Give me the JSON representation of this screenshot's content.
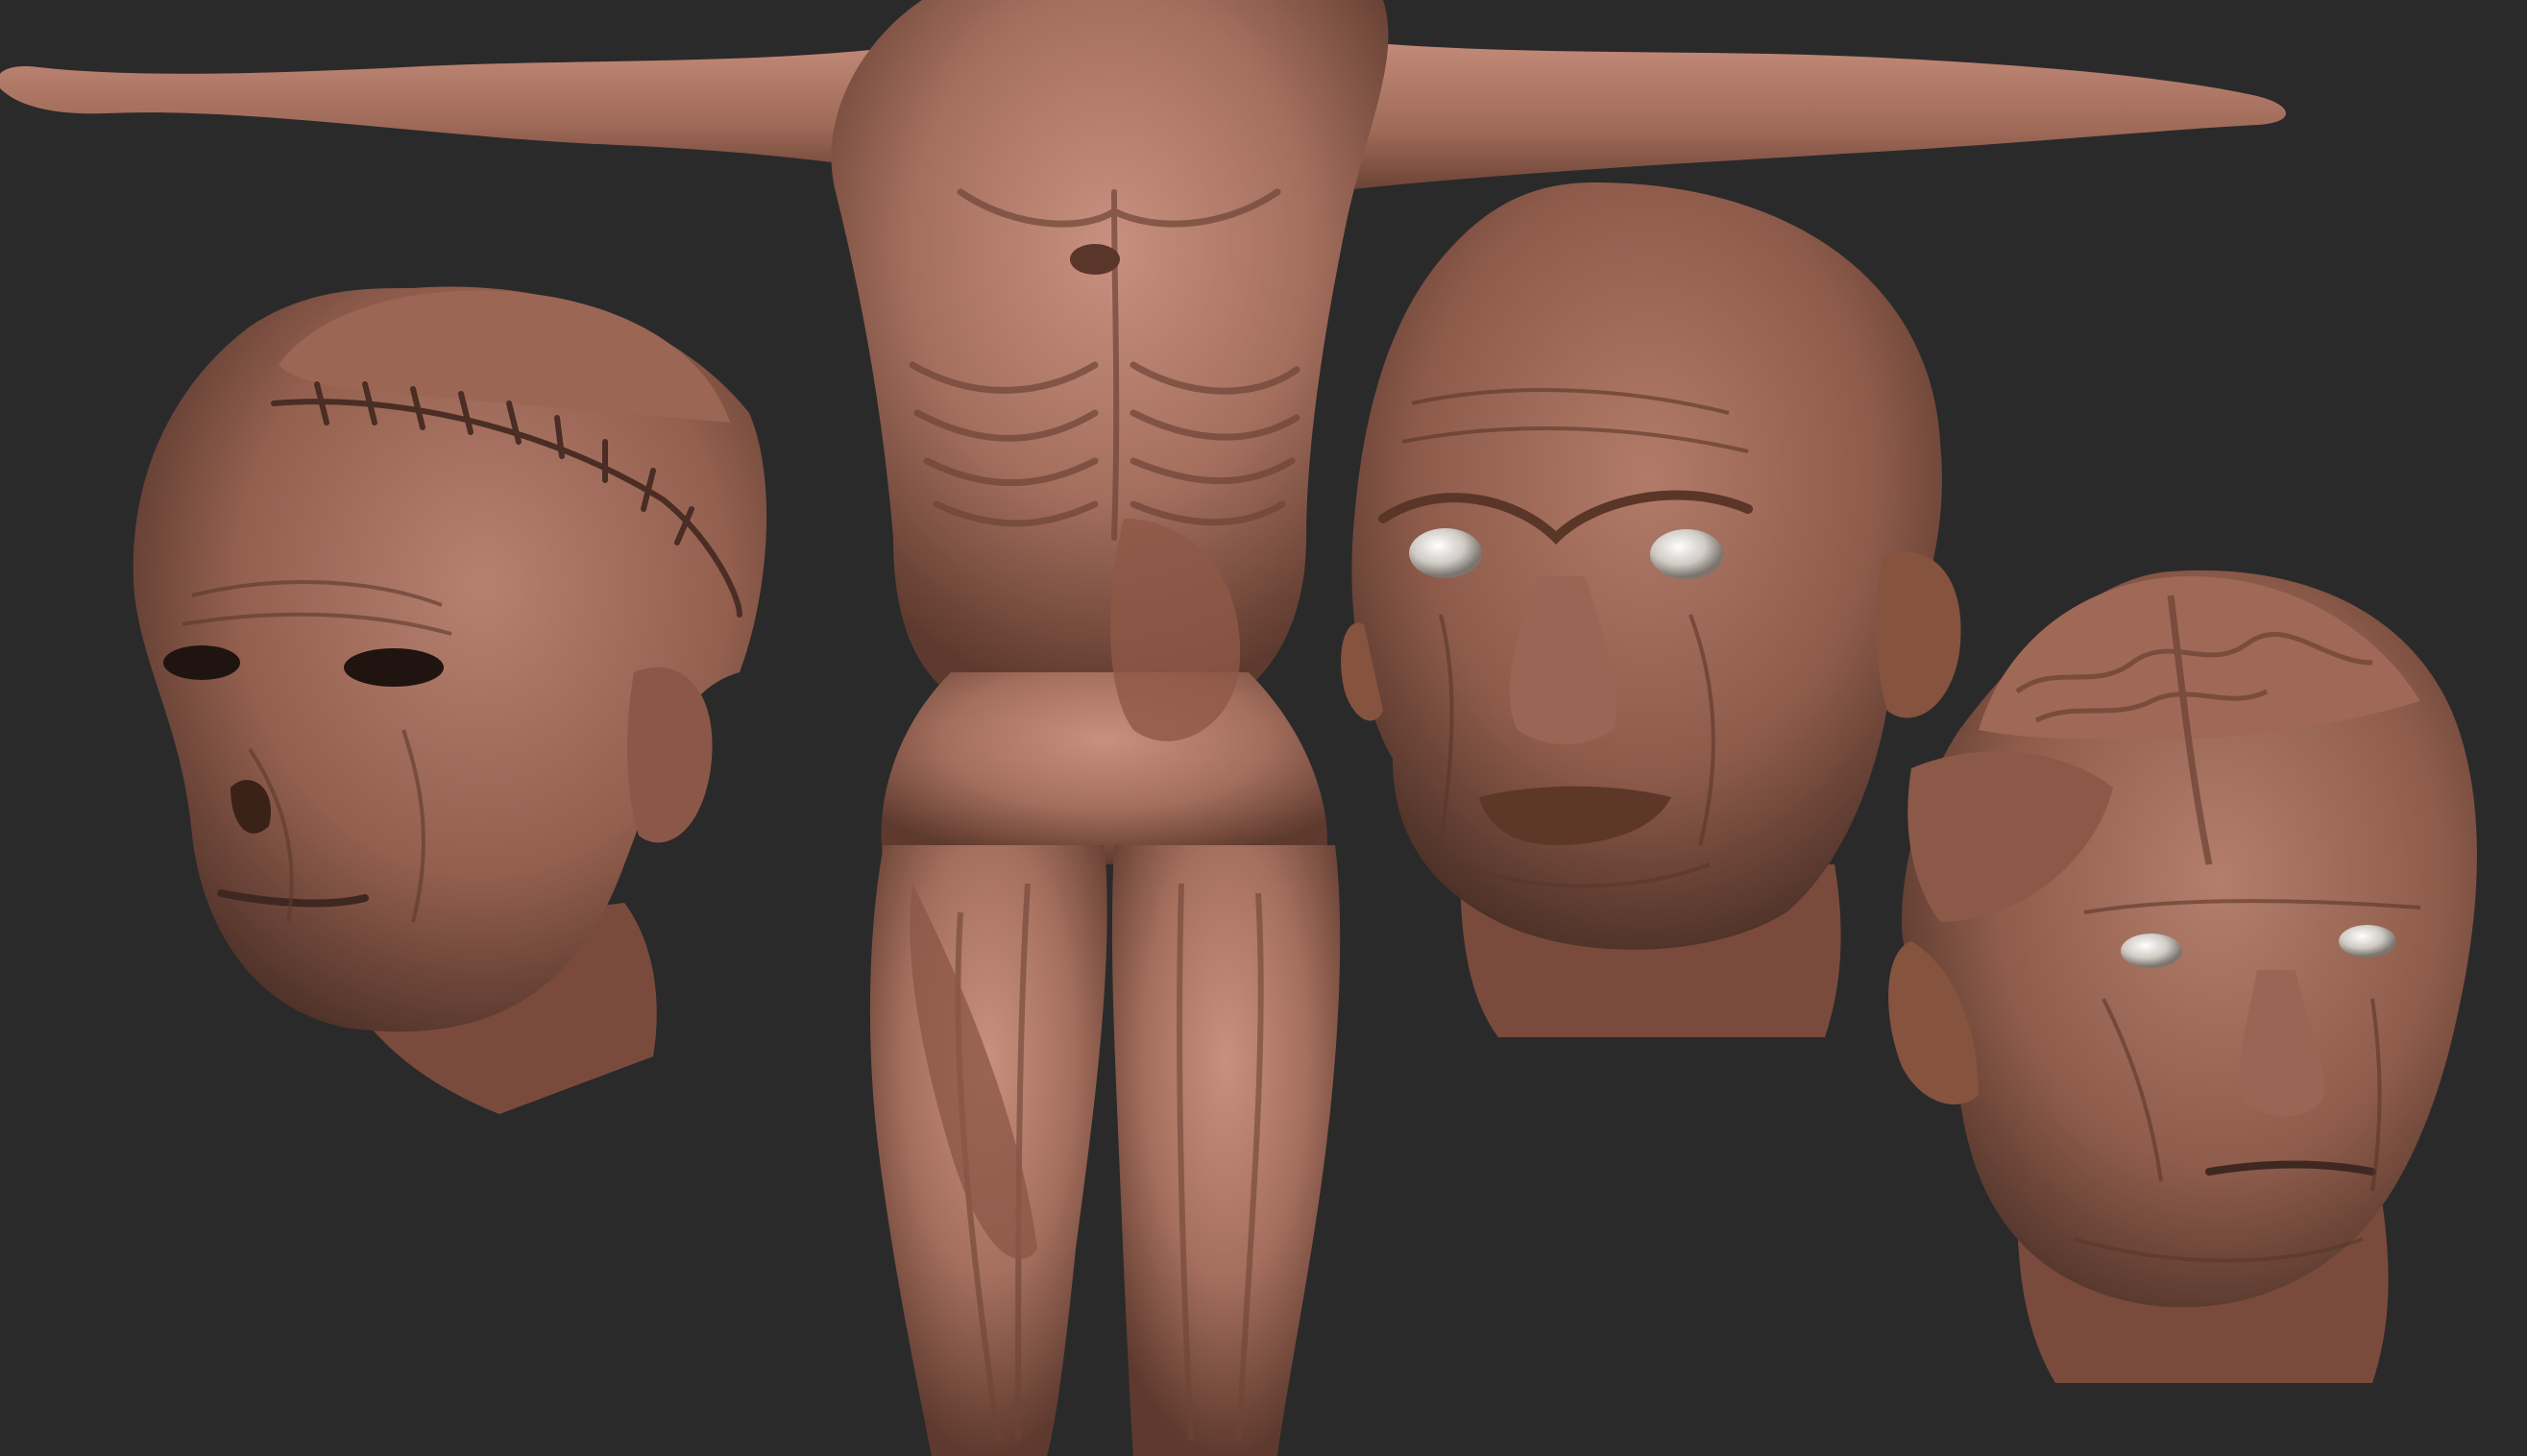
{
  "canvas": {
    "background_color": "#2a2a2b"
  },
  "palette": {
    "skin_base": "#a56f5e",
    "skin_light": "#c99080",
    "skin_dark": "#6e4436",
    "skin_shadow": "#3f2822",
    "eye_white": "#d9d5d0"
  },
  "sculpts": [
    {
      "id": "full-body",
      "description_icon": "creature-body-icon"
    },
    {
      "id": "left-head",
      "description_icon": "stitched-skull-head-icon"
    },
    {
      "id": "center-head",
      "description_icon": "decayed-face-head-icon"
    },
    {
      "id": "right-head",
      "description_icon": "exposed-brain-head-icon"
    }
  ]
}
